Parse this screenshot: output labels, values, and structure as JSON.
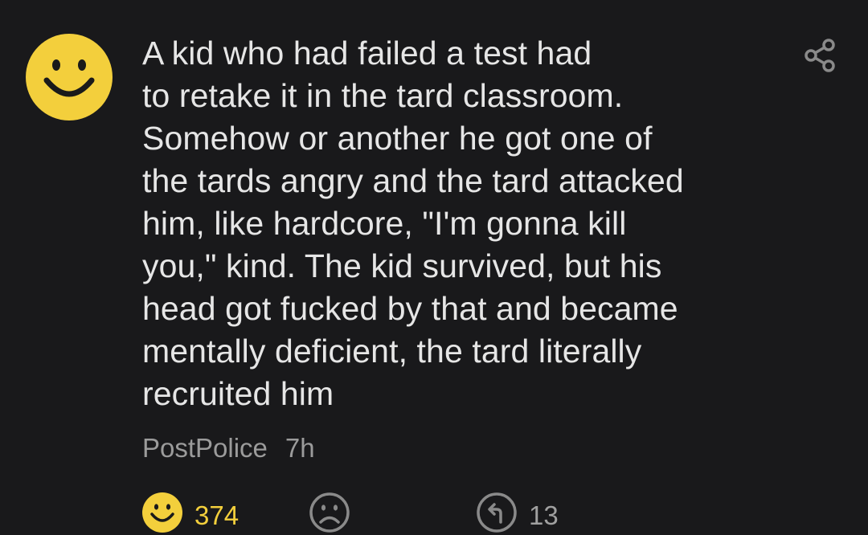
{
  "comment": {
    "text": "A kid who had failed a test had\nto retake it in the tard classroom.\nSomehow or another he got one of\nthe tards angry and the tard attacked\nhim, like hardcore, \"I'm gonna kill\nyou,\" kind. The kid survived, but his\nhead got fucked by that and became\nmentally deficient, the tard literally\nrecruited him",
    "author": "PostPolice",
    "time": "7h"
  },
  "actions": {
    "likes": "374",
    "replies": "13"
  },
  "colors": {
    "background": "#19191b",
    "text": "#e6e6e6",
    "meta": "#9b9b9b",
    "accent_yellow": "#f3cf3c",
    "icon_gray": "#8a8a8a"
  },
  "icons": {
    "avatar": "smiley-face-icon",
    "share": "share-icon",
    "like": "smiley-like-icon",
    "dislike": "frowny-dislike-icon",
    "reply": "reply-arrow-icon"
  }
}
